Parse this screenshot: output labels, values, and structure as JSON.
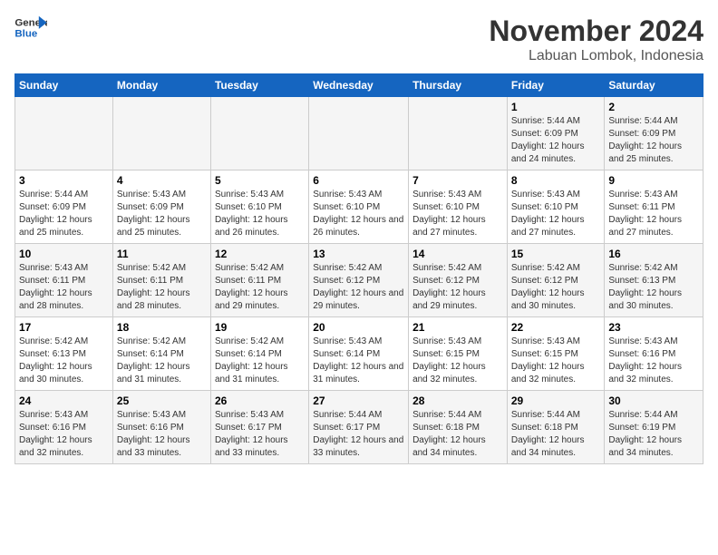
{
  "logo": {
    "line1": "General",
    "line2": "Blue"
  },
  "title": "November 2024",
  "subtitle": "Labuan Lombok, Indonesia",
  "days_of_week": [
    "Sunday",
    "Monday",
    "Tuesday",
    "Wednesday",
    "Thursday",
    "Friday",
    "Saturday"
  ],
  "weeks": [
    [
      {
        "day": "",
        "info": ""
      },
      {
        "day": "",
        "info": ""
      },
      {
        "day": "",
        "info": ""
      },
      {
        "day": "",
        "info": ""
      },
      {
        "day": "",
        "info": ""
      },
      {
        "day": "1",
        "info": "Sunrise: 5:44 AM\nSunset: 6:09 PM\nDaylight: 12 hours and 24 minutes."
      },
      {
        "day": "2",
        "info": "Sunrise: 5:44 AM\nSunset: 6:09 PM\nDaylight: 12 hours and 25 minutes."
      }
    ],
    [
      {
        "day": "3",
        "info": "Sunrise: 5:44 AM\nSunset: 6:09 PM\nDaylight: 12 hours and 25 minutes."
      },
      {
        "day": "4",
        "info": "Sunrise: 5:43 AM\nSunset: 6:09 PM\nDaylight: 12 hours and 25 minutes."
      },
      {
        "day": "5",
        "info": "Sunrise: 5:43 AM\nSunset: 6:10 PM\nDaylight: 12 hours and 26 minutes."
      },
      {
        "day": "6",
        "info": "Sunrise: 5:43 AM\nSunset: 6:10 PM\nDaylight: 12 hours and 26 minutes."
      },
      {
        "day": "7",
        "info": "Sunrise: 5:43 AM\nSunset: 6:10 PM\nDaylight: 12 hours and 27 minutes."
      },
      {
        "day": "8",
        "info": "Sunrise: 5:43 AM\nSunset: 6:10 PM\nDaylight: 12 hours and 27 minutes."
      },
      {
        "day": "9",
        "info": "Sunrise: 5:43 AM\nSunset: 6:11 PM\nDaylight: 12 hours and 27 minutes."
      }
    ],
    [
      {
        "day": "10",
        "info": "Sunrise: 5:43 AM\nSunset: 6:11 PM\nDaylight: 12 hours and 28 minutes."
      },
      {
        "day": "11",
        "info": "Sunrise: 5:42 AM\nSunset: 6:11 PM\nDaylight: 12 hours and 28 minutes."
      },
      {
        "day": "12",
        "info": "Sunrise: 5:42 AM\nSunset: 6:11 PM\nDaylight: 12 hours and 29 minutes."
      },
      {
        "day": "13",
        "info": "Sunrise: 5:42 AM\nSunset: 6:12 PM\nDaylight: 12 hours and 29 minutes."
      },
      {
        "day": "14",
        "info": "Sunrise: 5:42 AM\nSunset: 6:12 PM\nDaylight: 12 hours and 29 minutes."
      },
      {
        "day": "15",
        "info": "Sunrise: 5:42 AM\nSunset: 6:12 PM\nDaylight: 12 hours and 30 minutes."
      },
      {
        "day": "16",
        "info": "Sunrise: 5:42 AM\nSunset: 6:13 PM\nDaylight: 12 hours and 30 minutes."
      }
    ],
    [
      {
        "day": "17",
        "info": "Sunrise: 5:42 AM\nSunset: 6:13 PM\nDaylight: 12 hours and 30 minutes."
      },
      {
        "day": "18",
        "info": "Sunrise: 5:42 AM\nSunset: 6:14 PM\nDaylight: 12 hours and 31 minutes."
      },
      {
        "day": "19",
        "info": "Sunrise: 5:42 AM\nSunset: 6:14 PM\nDaylight: 12 hours and 31 minutes."
      },
      {
        "day": "20",
        "info": "Sunrise: 5:43 AM\nSunset: 6:14 PM\nDaylight: 12 hours and 31 minutes."
      },
      {
        "day": "21",
        "info": "Sunrise: 5:43 AM\nSunset: 6:15 PM\nDaylight: 12 hours and 32 minutes."
      },
      {
        "day": "22",
        "info": "Sunrise: 5:43 AM\nSunset: 6:15 PM\nDaylight: 12 hours and 32 minutes."
      },
      {
        "day": "23",
        "info": "Sunrise: 5:43 AM\nSunset: 6:16 PM\nDaylight: 12 hours and 32 minutes."
      }
    ],
    [
      {
        "day": "24",
        "info": "Sunrise: 5:43 AM\nSunset: 6:16 PM\nDaylight: 12 hours and 32 minutes."
      },
      {
        "day": "25",
        "info": "Sunrise: 5:43 AM\nSunset: 6:16 PM\nDaylight: 12 hours and 33 minutes."
      },
      {
        "day": "26",
        "info": "Sunrise: 5:43 AM\nSunset: 6:17 PM\nDaylight: 12 hours and 33 minutes."
      },
      {
        "day": "27",
        "info": "Sunrise: 5:44 AM\nSunset: 6:17 PM\nDaylight: 12 hours and 33 minutes."
      },
      {
        "day": "28",
        "info": "Sunrise: 5:44 AM\nSunset: 6:18 PM\nDaylight: 12 hours and 34 minutes."
      },
      {
        "day": "29",
        "info": "Sunrise: 5:44 AM\nSunset: 6:18 PM\nDaylight: 12 hours and 34 minutes."
      },
      {
        "day": "30",
        "info": "Sunrise: 5:44 AM\nSunset: 6:19 PM\nDaylight: 12 hours and 34 minutes."
      }
    ]
  ]
}
